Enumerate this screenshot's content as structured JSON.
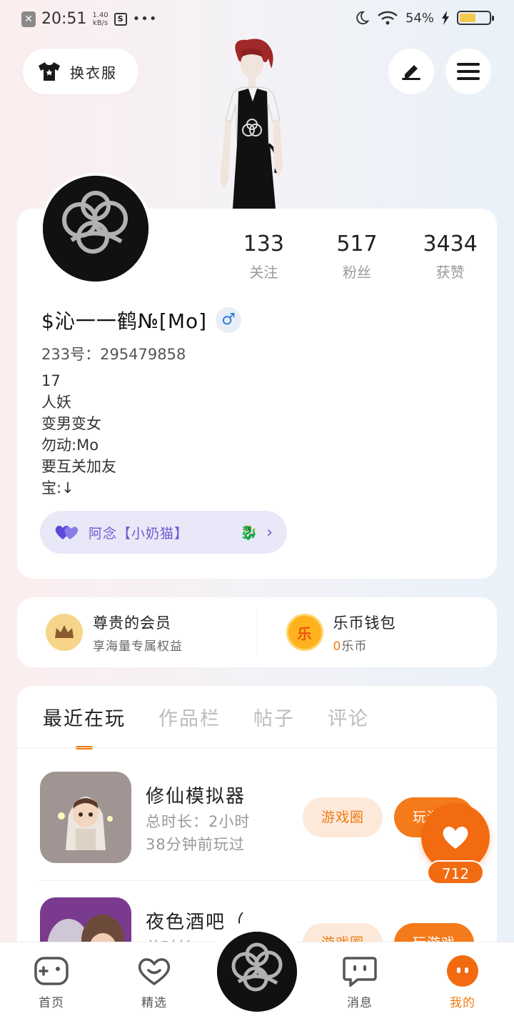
{
  "status_bar": {
    "time": "20:51",
    "speed_value": "1.40",
    "speed_unit": "kB/s",
    "battery": "54%",
    "battery_level": 0.54
  },
  "header": {
    "outfit_label": "换衣服"
  },
  "profile": {
    "stats": [
      {
        "value": "133",
        "label": "关注"
      },
      {
        "value": "517",
        "label": "粉丝"
      },
      {
        "value": "3434",
        "label": "获赞"
      }
    ],
    "username": "$沁一一鹤№[Mo]",
    "gender_symbol": "♂",
    "uid": "233号：295479858",
    "bio": [
      "17",
      "人妖",
      "变男变女",
      "勿动:Mo",
      "要互关加友",
      "宝:↓"
    ],
    "friend_label": "阿念【小奶猫】",
    "friend_chevron": "›"
  },
  "vip": {
    "member_title": "尊贵的会员",
    "member_sub": "享海量专属权益",
    "wallet_title": "乐币钱包",
    "wallet_amount": "0",
    "wallet_unit": "乐币",
    "coin_glyph": "乐"
  },
  "tabs": [
    {
      "label": "最近在玩",
      "active": true
    },
    {
      "label": "作品栏",
      "active": false
    },
    {
      "label": "帖子",
      "active": false
    },
    {
      "label": "评论",
      "active": false
    }
  ],
  "games": [
    {
      "name": "修仙模拟器",
      "time": "总时长：2小时",
      "last": "38分钟前玩过",
      "circle": "游戏圈",
      "play": "玩游戏"
    },
    {
      "name": "夜色酒吧（…",
      "time": "总时长：…",
      "last": "",
      "circle": "游戏圈",
      "play": "玩游戏"
    }
  ],
  "like": {
    "count": "712"
  },
  "nav": [
    {
      "label": "首页",
      "icon": "gamepad-icon"
    },
    {
      "label": "精选",
      "icon": "heart-face-icon"
    },
    {
      "label": "消息",
      "icon": "chat-icon"
    },
    {
      "label": "我的",
      "icon": "profile-face-icon",
      "active": true
    }
  ],
  "colors": {
    "accent": "#f07a12",
    "friend": "#6d5bd0",
    "gender": "#2d7ad6"
  }
}
